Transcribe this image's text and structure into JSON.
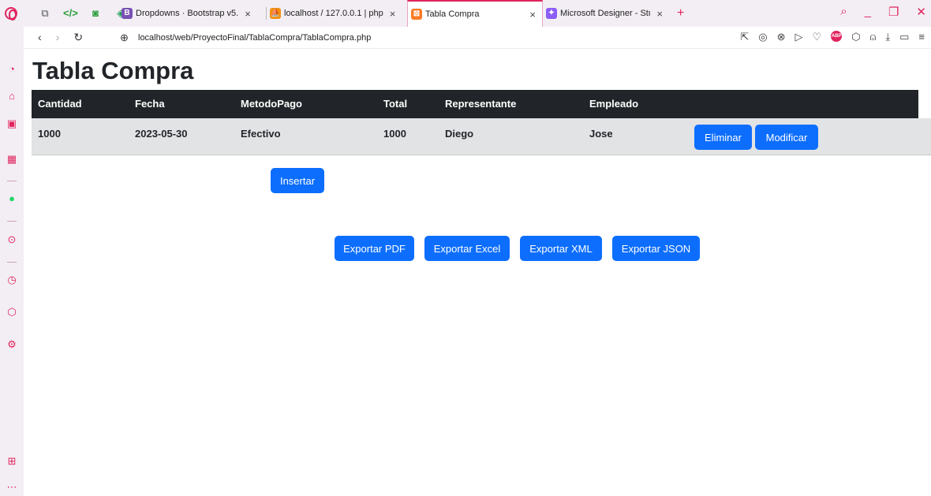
{
  "browser": {
    "tabs": [
      {
        "title": "Dropdowns · Bootstrap v5.",
        "favicon": "bootstrap-icon",
        "color": "#7952b3",
        "close": "×"
      },
      {
        "title": "localhost / 127.0.0.1 | php",
        "favicon": "phpmyadmin-icon",
        "color": "#f29111",
        "close": "×"
      },
      {
        "title": "Tabla Compra",
        "favicon": "xampp-icon",
        "color": "#fb7a24",
        "close": "×"
      },
      {
        "title": "Microsoft Designer - Stunn",
        "favicon": "designer-icon",
        "color": "#8b5cf6",
        "close": "×"
      }
    ],
    "new_tab": "+",
    "url": "localhost/web/ProyectoFinal/TablaCompra/TablaCompra.php"
  },
  "page": {
    "title": "Tabla Compra",
    "table": {
      "headers": [
        "Cantidad",
        "Fecha",
        "MetodoPago",
        "Total",
        "Representante",
        "Empleado"
      ],
      "rows": [
        {
          "cells": [
            "1000",
            "2023-05-30",
            "Efectivo",
            "1000",
            "Diego",
            "Jose"
          ],
          "delete_label": "Eliminar",
          "edit_label": "Modificar"
        }
      ]
    },
    "insert_label": "Insertar",
    "export": {
      "pdf": "Exportar PDF",
      "excel": "Exportar Excel",
      "xml": "Exportar XML",
      "json": "Exportar JSON"
    }
  },
  "colors": {
    "primary": "#0d6efd",
    "table_header": "#212529",
    "table_row": "#e2e3e5",
    "browser_accent": "#e0245e"
  }
}
